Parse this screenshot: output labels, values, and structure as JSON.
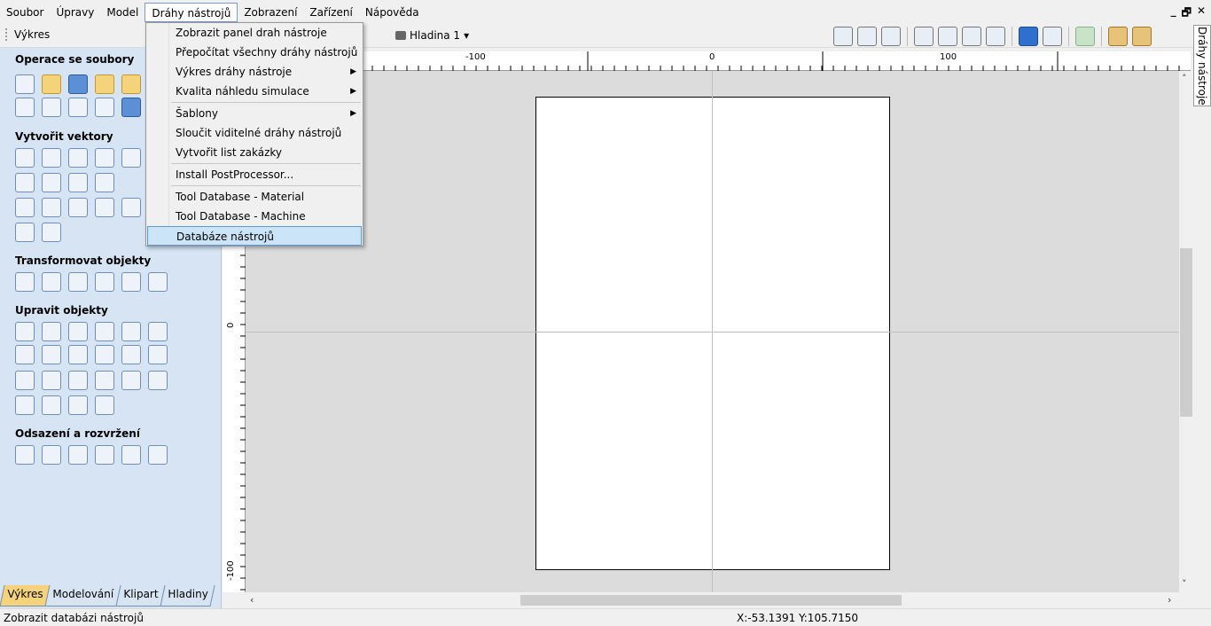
{
  "menubar": {
    "items": [
      "Soubor",
      "Úpravy",
      "Model",
      "Dráhy nástrojů",
      "Zobrazení",
      "Zařízení",
      "Nápověda"
    ],
    "active_index": 3
  },
  "window_controls": {
    "minimize": "_",
    "restore": "🗗",
    "close": "✕"
  },
  "toolbar": {
    "panel_label": "Výkres",
    "layer_label": "Hladina 1",
    "layer_arrow": "▾"
  },
  "left_panel": {
    "sections": [
      {
        "title": "Operace se soubory",
        "rows": [
          6,
          5
        ]
      },
      {
        "title": "Vytvořit vektory",
        "rows": [
          5,
          4,
          5,
          2
        ]
      },
      {
        "title": "Transformovat objekty",
        "rows": [
          6
        ]
      },
      {
        "title": "Upravit objekty",
        "rows": [
          6,
          6,
          6,
          4
        ]
      },
      {
        "title": "Odsazení a rozvržení",
        "rows": [
          6
        ]
      }
    ],
    "tabs": [
      "Výkres",
      "Modelování",
      "Klipart",
      "Hladiny"
    ],
    "active_tab": 0
  },
  "right_tab": {
    "label": "Dráhy nástroje"
  },
  "rulers": {
    "h_labels": [
      "-100",
      "0",
      "100"
    ],
    "v_labels": [
      "0",
      "-100"
    ]
  },
  "dropdown": {
    "items": [
      {
        "label": "Zobrazit panel drah nástroje",
        "submenu": false
      },
      {
        "label": "Přepočítat všechny dráhy nástrojů",
        "submenu": false
      },
      {
        "label": "Výkres dráhy nástroje",
        "submenu": true
      },
      {
        "label": "Kvalita náhledu simulace",
        "submenu": true
      },
      {
        "label": "Šablony",
        "submenu": true
      },
      {
        "label": "Sloučit viditelné dráhy nástrojů",
        "submenu": false
      },
      {
        "label": "Vytvořit list zakázky",
        "submenu": false
      },
      {
        "label": "Install PostProcessor...",
        "submenu": false
      },
      {
        "label": "Tool Database - Material",
        "submenu": false
      },
      {
        "label": "Tool Database - Machine",
        "submenu": false
      },
      {
        "label": "Databáze nástrojů",
        "submenu": false
      }
    ],
    "selected_index": 10,
    "submenu_arrow": "▶"
  },
  "statusbar": {
    "text": "Zobrazit databázi nástrojů",
    "coords": "X:-53.1391 Y:105.7150"
  },
  "colors": {
    "panel": "#d6e4f3",
    "accent": "#5b9bd5",
    "tab_active": "#f5d37a"
  }
}
